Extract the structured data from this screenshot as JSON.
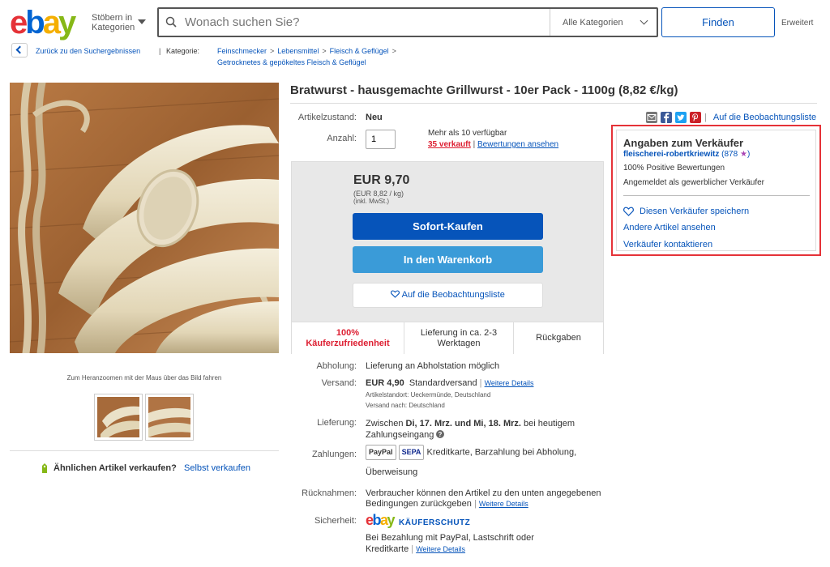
{
  "header": {
    "browse_label": "Stöbern in Kategorien",
    "search_placeholder": "Wonach suchen Sie?",
    "category_select": "Alle Kategorien",
    "find_label": "Finden",
    "advanced_label": "Erweitert"
  },
  "breadcrumb": {
    "back_label": "Zurück zu den Suchergebnissen",
    "category_label": "Kategorie:",
    "line1": [
      "Feinschmecker",
      "Lebensmittel",
      "Fleisch & Geflügel"
    ],
    "line2": "Getrocknetes & gepökeltes Fleisch & Geflügel"
  },
  "gallery": {
    "zoom_hint": "Zum Heranzoomen mit der Maus über das Bild fahren",
    "sell_question": "Ähnlichen Artikel verkaufen?",
    "sell_link": "Selbst verkaufen"
  },
  "item": {
    "title": "Bratwurst - hausgemachte Grillwurst - 10er Pack - 1100g (8,82 €/kg)",
    "condition_label": "Artikelzustand:",
    "condition_value": "Neu",
    "quantity_label": "Anzahl:",
    "quantity_value": "1",
    "available": "Mehr als 10 verfügbar",
    "sold": "35 verkauft",
    "reviews_link": "Bewertungen ansehen",
    "watch_link": "Auf die Beobachtungsliste"
  },
  "buybox": {
    "price": "EUR 9,70",
    "unit_price": "(EUR 8,82 / kg)",
    "tax_note": "(inkl. MwSt.)",
    "buy_now": "Sofort-Kaufen",
    "add_to_cart": "In den Warenkorb",
    "watch": "Auf die Beobachtungsliste",
    "trust": [
      "100% Käuferzufriedenheit",
      "Lieferung in ca. 2-3 Werktagen",
      "Rückgaben"
    ]
  },
  "seller": {
    "heading": "Angaben zum Verkäufer",
    "name": "fleischerei-robertkriewitz",
    "rating_count": "878",
    "positive": "100% Positive Bewertungen",
    "registered": "Angemeldet als gewerblicher Verkäufer",
    "save": "Diesen Verkäufer speichern",
    "other_items": "Andere Artikel ansehen",
    "contact": "Verkäufer kontaktieren"
  },
  "info": {
    "pickup_label": "Abholung:",
    "pickup_value": "Lieferung an Abholstation möglich",
    "shipping_label": "Versand:",
    "shipping_price": "EUR 4,90",
    "shipping_method": "Standardversand",
    "details_link": "Weitere Details",
    "item_location": "Artikelstandort:  Ueckermünde, Deutschland",
    "ships_to": "Versand nach:  Deutschland",
    "delivery_label": "Lieferung:",
    "delivery_prefix": "Zwischen",
    "delivery_range": "Di, 17. Mrz. und Mi, 18. Mrz.",
    "delivery_suffix": "bei heutigem",
    "delivery_line2": "Zahlungseingang",
    "payment_label": "Zahlungen:",
    "payment_methods": "Kreditkarte, Barzahlung bei Abholung,",
    "payment_line2": "Überweisung",
    "paypal_logo": "PayPal",
    "sepa_logo": "SEPA",
    "returns_label": "Rücknahmen:",
    "returns_line1": "Verbraucher können den Artikel zu den unten angegebenen",
    "returns_line2": "Bedingungen zurückgeben",
    "security_label": "Sicherheit:",
    "buyer_protection": "KÄUFERSCHUTZ",
    "security_line1": "Bei Bezahlung mit PayPal, Lastschrift oder",
    "security_line2": "Kreditkarte"
  },
  "logo": {
    "e": "e",
    "b": "b",
    "a": "a",
    "y": "y"
  }
}
